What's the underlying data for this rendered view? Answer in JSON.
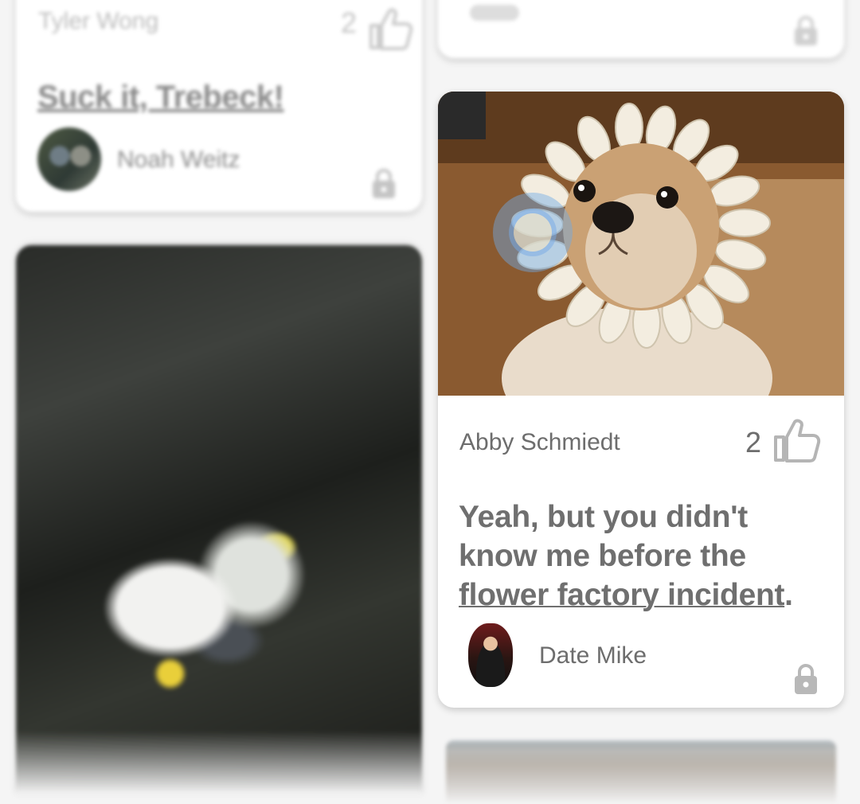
{
  "cards": {
    "top_left": {
      "author": "Tyler Wong",
      "like_count": "2",
      "title": "Suck it, Trebeck!",
      "poster": "Noah Weitz"
    },
    "dog": {
      "author": "Abby Schmiedt",
      "like_count": "2",
      "quote_prefix": "Yeah, but you didn't know me before the ",
      "quote_link": "flower factory incident",
      "quote_suffix": ".",
      "poster": "Date Mike"
    }
  },
  "icons": {
    "like": "thumbs-up-icon",
    "lock": "lock-icon"
  },
  "colors": {
    "background": "#f5f5f5",
    "card": "#ffffff",
    "text_primary": "#6f6f6f",
    "icon_gray": "#b8b8b8"
  }
}
